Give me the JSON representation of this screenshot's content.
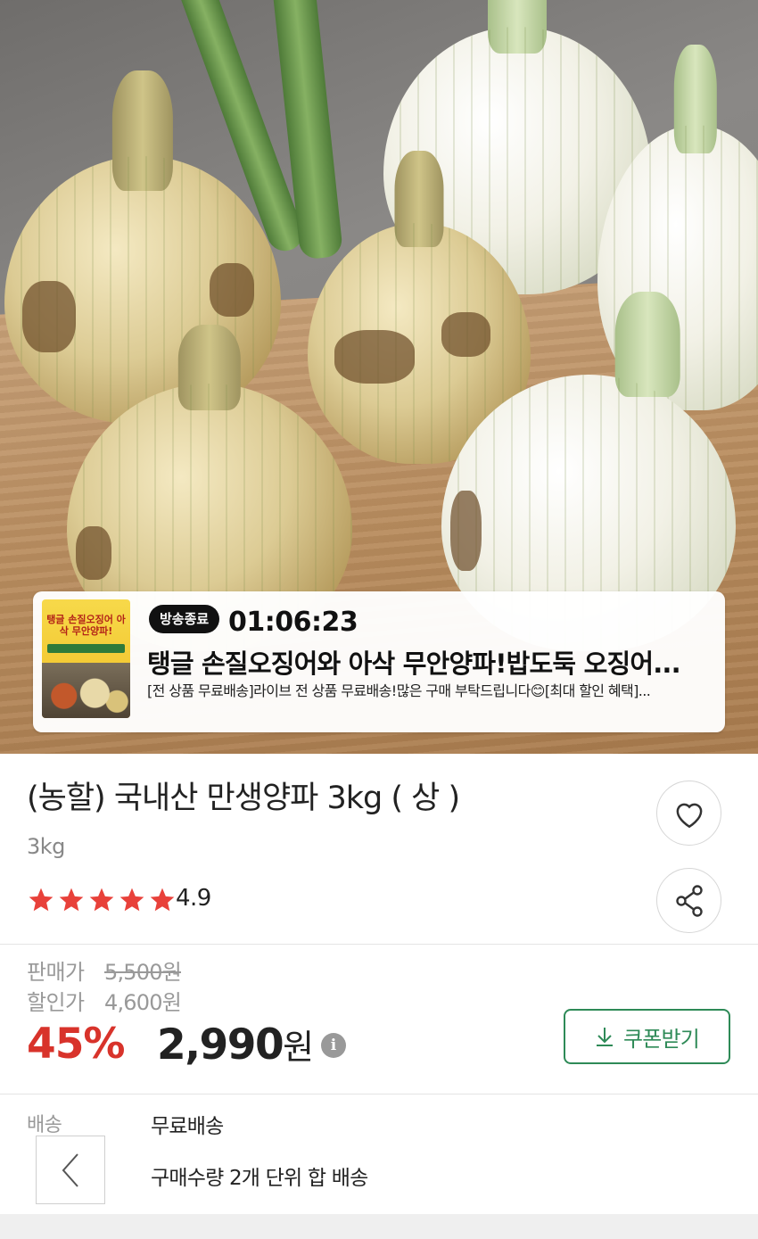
{
  "hero": {
    "image_subject": "onions"
  },
  "live": {
    "badge": "방송종료",
    "time": "01:06:23",
    "title": "탱글 손질오징어와 아삭 무안양파!밥도둑 오징어...",
    "description": "[전 상품 무료배송]라이브 전 상품 무료배송!많은 구매 부탁드립니다😊[최대 할인 혜택]...",
    "thumbnail_text": "탱글 손질오징어 아삭 무안양파!"
  },
  "product": {
    "title": "(농할) 국내산 만생양파 3kg ( 상 )",
    "option": "3kg",
    "rating": "4.9",
    "rating_value": 4.9,
    "rating_max": 5,
    "star_color": "#e8413a"
  },
  "price": {
    "sell_label": "판매가",
    "sell_value": "5,500원",
    "discount_label": "할인가",
    "discount_value": "4,600원",
    "percent": "45%",
    "final": "2,990",
    "final_unit": "원",
    "info_icon": "i",
    "percent_color": "#d8332b"
  },
  "coupon": {
    "label": "쿠폰받기",
    "icon": "download-icon",
    "color": "#2e8a57"
  },
  "shipping": {
    "label": "배송",
    "value": "무료배송",
    "note": "구매수량 2개 단위 합 배송"
  },
  "icons": {
    "like": "heart-icon",
    "share": "share-icon",
    "back": "chevron-left-icon"
  }
}
